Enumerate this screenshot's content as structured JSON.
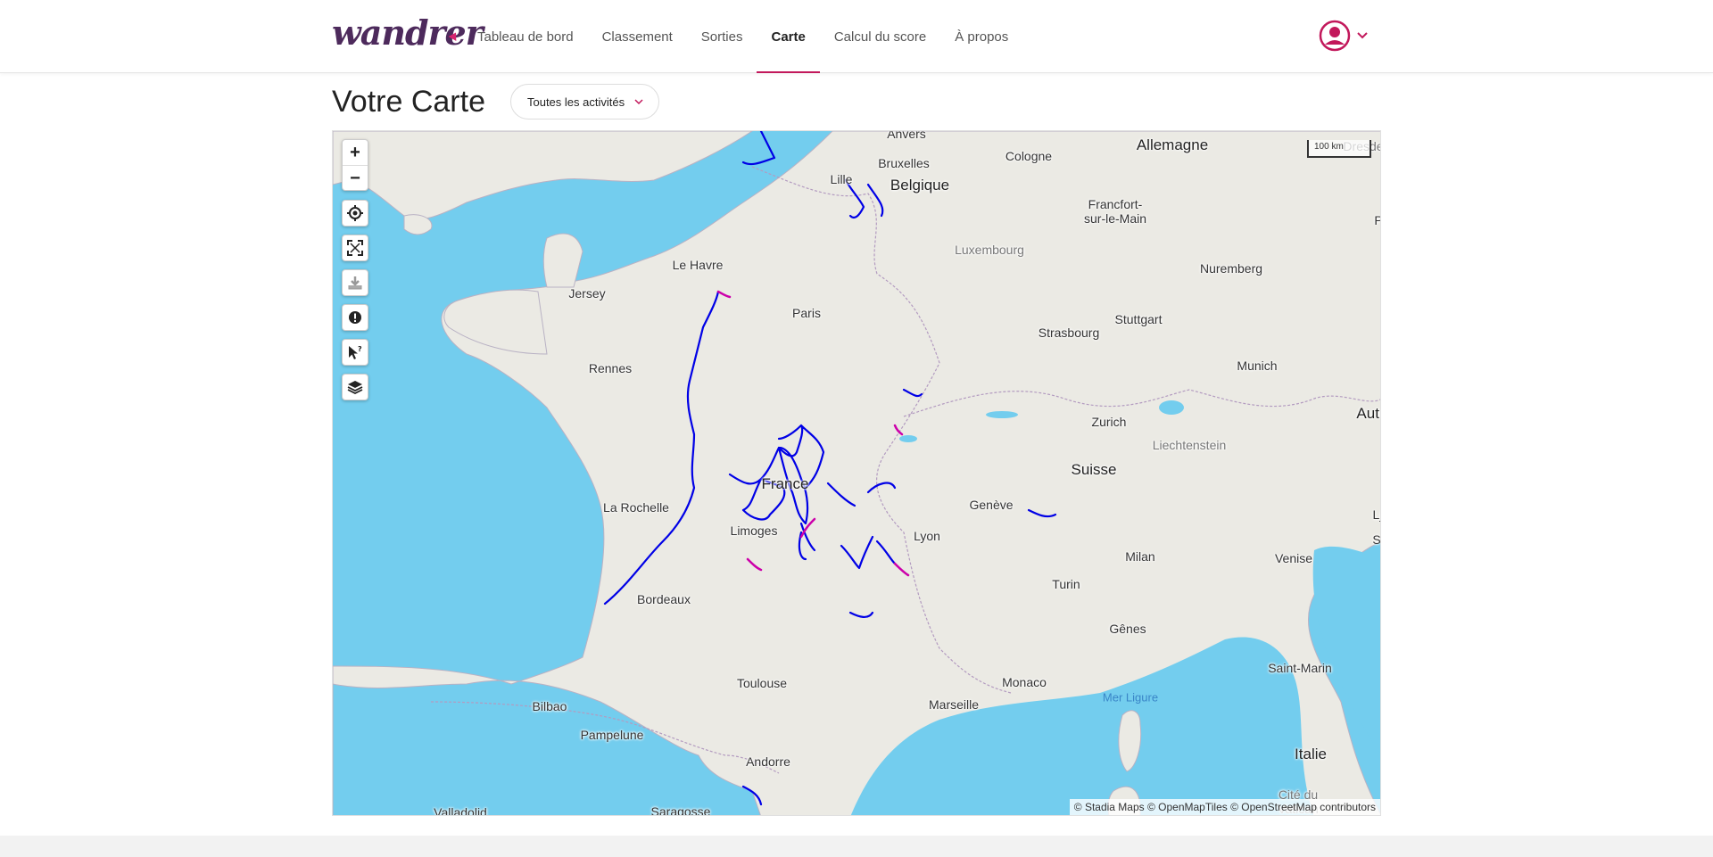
{
  "nav": {
    "logo": "wandrer",
    "links": [
      "Tableau de bord",
      "Classement",
      "Sorties",
      "Carte",
      "Calcul du score",
      "À propos"
    ],
    "active": "Carte"
  },
  "page": {
    "title": "Votre Carte",
    "filter_value": "Toutes les activités"
  },
  "map": {
    "controls": {
      "zoom_in": "+",
      "zoom_out": "−"
    },
    "control_icons": [
      "crosshair-icon",
      "fullscreen-icon",
      "download-icon",
      "alert-icon",
      "cursor-help-icon",
      "layers-icon"
    ],
    "scale": "100 km",
    "attribution": "© Stadia Maps © OpenMapTiles © OpenStreetMap contributors",
    "labels": {
      "anvers": "Anvers",
      "bruxelles": "Bruxelles",
      "lille": "Lille",
      "belgique": "Belgique",
      "cologne": "Cologne",
      "allemagne": "Allemagne",
      "dresde": "Dresde",
      "francfort": "Francfort-\nsur-le-Main",
      "luxembourg": "Luxembourg",
      "le_havre": "Le Havre",
      "jersey": "Jersey",
      "paris": "Paris",
      "nuremberg": "Nuremberg",
      "stuttgart": "Stuttgart",
      "strasbourg": "Strasbourg",
      "rennes": "Rennes",
      "munich": "Munich",
      "p": "P",
      "zurich": "Zurich",
      "liechtenstein": "Liechtenstein",
      "autr": "Autr",
      "suisse": "Suisse",
      "france": "France",
      "geneve": "Genève",
      "la_rochelle": "La Rochelle",
      "limoges": "Limoges",
      "lyon": "Lyon",
      "milan": "Milan",
      "venise": "Venise",
      "lj": "Lj",
      "s": "S",
      "turin": "Turin",
      "bordeaux": "Bordeaux",
      "genes": "Gênes",
      "saint_marin": "Saint-Marin",
      "toulouse": "Toulouse",
      "monaco": "Monaco",
      "mer_ligure": "Mer Ligure",
      "bilbao": "Bilbao",
      "marseille": "Marseille",
      "pampelune": "Pampelune",
      "italie": "Italie",
      "andorre": "Andorre",
      "cite_du_vatican": "Cité du\nVatican",
      "valladolid": "Valladolid",
      "saragosse": "Saragosse"
    }
  },
  "colors": {
    "accent": "#c2185b",
    "logo": "#4d2a5c",
    "route_primary": "#0000e6",
    "route_secondary": "#cc00aa",
    "sea": "#73cdee",
    "land": "#ebeae4"
  }
}
